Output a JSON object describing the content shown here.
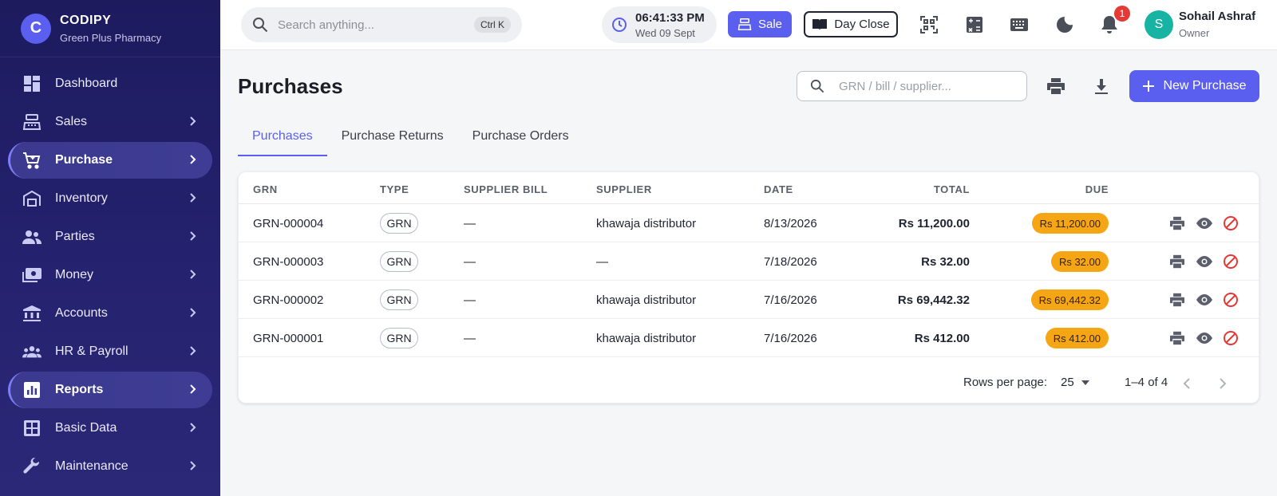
{
  "brand": {
    "logo_letter": "C",
    "name": "CODIPY",
    "subtitle": "Green Plus Pharmacy"
  },
  "sidebar": {
    "items": [
      {
        "label": "Dashboard",
        "icon": "dashboard-icon",
        "has_chevron": false,
        "active": false
      },
      {
        "label": "Sales",
        "icon": "register-icon",
        "has_chevron": true,
        "active": false
      },
      {
        "label": "Purchase",
        "icon": "cart-icon",
        "has_chevron": true,
        "active": true
      },
      {
        "label": "Inventory",
        "icon": "warehouse-icon",
        "has_chevron": true,
        "active": false
      },
      {
        "label": "Parties",
        "icon": "people-icon",
        "has_chevron": true,
        "active": false
      },
      {
        "label": "Money",
        "icon": "money-icon",
        "has_chevron": true,
        "active": false
      },
      {
        "label": "Accounts",
        "icon": "bank-icon",
        "has_chevron": true,
        "active": false
      },
      {
        "label": "HR & Payroll",
        "icon": "groups-icon",
        "has_chevron": true,
        "active": false
      },
      {
        "label": "Reports",
        "icon": "chart-icon",
        "has_chevron": true,
        "active": true
      },
      {
        "label": "Basic Data",
        "icon": "grid-icon",
        "has_chevron": true,
        "active": false
      },
      {
        "label": "Maintenance",
        "icon": "wrench-icon",
        "has_chevron": true,
        "active": false
      }
    ]
  },
  "topbar": {
    "search_placeholder": "Search anything...",
    "search_shortcut": "Ctrl K",
    "time": "06:41:33 PM",
    "date": "Wed 09 Sept",
    "sale_label": "Sale",
    "day_close_label": "Day Close",
    "notification_count": "1",
    "user": {
      "initial": "S",
      "name": "Sohail Ashraf",
      "role": "Owner"
    }
  },
  "page": {
    "title": "Purchases",
    "filter_placeholder": "GRN / bill / supplier...",
    "new_button_label": "New Purchase",
    "tabs": [
      {
        "label": "Purchases",
        "active": true
      },
      {
        "label": "Purchase Returns",
        "active": false
      },
      {
        "label": "Purchase Orders",
        "active": false
      }
    ]
  },
  "table": {
    "columns": {
      "grn": "GRN",
      "type": "TYPE",
      "bill": "SUPPLIER BILL",
      "supplier": "SUPPLIER",
      "date": "DATE",
      "total": "TOTAL",
      "due": "DUE"
    },
    "rows": [
      {
        "grn": "GRN-000004",
        "type": "GRN",
        "bill": "—",
        "supplier": "khawaja distributor",
        "date": "8/13/2026",
        "total": "Rs 11,200.00",
        "due": "Rs 11,200.00"
      },
      {
        "grn": "GRN-000003",
        "type": "GRN",
        "bill": "—",
        "supplier": "—",
        "date": "7/18/2026",
        "total": "Rs 32.00",
        "due": "Rs 32.00"
      },
      {
        "grn": "GRN-000002",
        "type": "GRN",
        "bill": "—",
        "supplier": "khawaja distributor",
        "date": "7/16/2026",
        "total": "Rs 69,442.32",
        "due": "Rs 69,442.32"
      },
      {
        "grn": "GRN-000001",
        "type": "GRN",
        "bill": "—",
        "supplier": "khawaja distributor",
        "date": "7/16/2026",
        "total": "Rs 412.00",
        "due": "Rs 412.00"
      }
    ],
    "rows_per_page_label": "Rows per page:",
    "rows_per_page": "25",
    "range": "1–4 of 4"
  },
  "colors": {
    "accent": "#5b5ff0",
    "sidebar": "#1d1b5e",
    "due_chip": "#f6a515",
    "void": "#e53935"
  }
}
